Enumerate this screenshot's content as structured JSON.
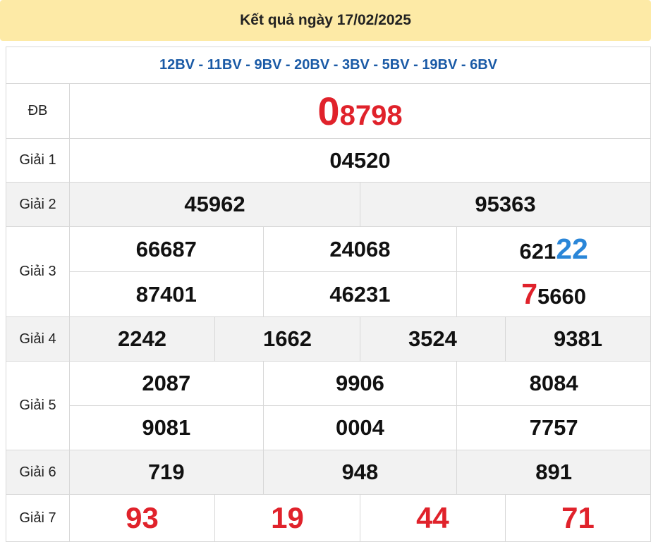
{
  "header": {
    "title": "Kết quả ngày 17/02/2025"
  },
  "codes": "12BV - 11BV - 9BV - 20BV - 3BV - 5BV - 19BV - 6BV",
  "labels": {
    "db": "ĐB",
    "g1": "Giải 1",
    "g2": "Giải 2",
    "g3": "Giải 3",
    "g4": "Giải 4",
    "g5": "Giải 5",
    "g6": "Giải 6",
    "g7": "Giải 7"
  },
  "prizes": {
    "db": {
      "first": "0",
      "rest": "8798"
    },
    "g1": [
      "04520"
    ],
    "g2": [
      "45962",
      "95363"
    ],
    "g3": [
      {
        "plain": "66687"
      },
      {
        "plain": "24068"
      },
      {
        "prefix": "621",
        "highlight": "22",
        "highlight_color": "blue"
      },
      {
        "plain": "87401"
      },
      {
        "plain": "46231"
      },
      {
        "highlight": "7",
        "suffix": "5660",
        "highlight_color": "red"
      }
    ],
    "g4": [
      "2242",
      "1662",
      "3524",
      "9381"
    ],
    "g5": [
      "2087",
      "9906",
      "8084",
      "9081",
      "0004",
      "7757"
    ],
    "g6": [
      "719",
      "948",
      "891"
    ],
    "g7": [
      "93",
      "19",
      "44",
      "71"
    ]
  },
  "colors": {
    "header_bg": "#fdeaa6",
    "codes": "#1a5aa6",
    "red": "#e0222b",
    "blue": "#2a86d8",
    "row_alt": "#f2f2f2"
  }
}
